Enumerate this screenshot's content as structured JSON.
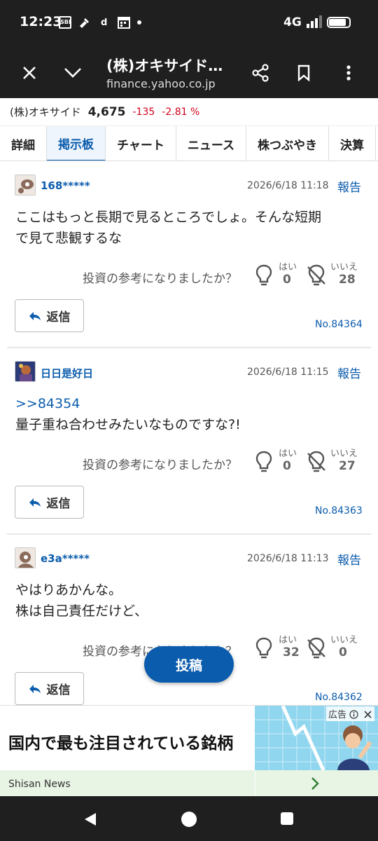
{
  "status_bar": {
    "time": "12:23",
    "network": "4G",
    "icons": [
      "sbi-icon",
      "tool-icon",
      "docomo-icon",
      "calendar-icon"
    ]
  },
  "browser": {
    "title": "(株)オキサイド…",
    "url": "finance.yahoo.co.jp"
  },
  "stock": {
    "name": "(株)オキサイド",
    "price": "4,675",
    "change": "-135",
    "change_pct": "-2.81 %"
  },
  "tabs": [
    {
      "label": "詳細"
    },
    {
      "label": "掲示板",
      "active": true
    },
    {
      "label": "チャート"
    },
    {
      "label": "ニュース"
    },
    {
      "label": "株つぶやき"
    },
    {
      "label": "決算"
    }
  ],
  "common": {
    "report_label": "報告",
    "helpful_question": "投資の参考になりましたか？",
    "yes_label": "はい",
    "no_label": "いいえ",
    "reply_label": "返信"
  },
  "posts": [
    {
      "user": "168*****",
      "date": "2026/6/18 11:18",
      "ref": "",
      "lines": [
        "ここはもっと長期で見るところでしょ。そんな短期",
        "で見て悲観するな"
      ],
      "yes": "0",
      "no": "28",
      "number": "No.84364"
    },
    {
      "user": "日日是好日",
      "date": "2026/6/18 11:15",
      "ref": ">>84354",
      "lines": [
        "量子重ね合わせみたいなものですな?!",
        ""
      ],
      "yes": "0",
      "no": "27",
      "number": "No.84363"
    },
    {
      "user": "e3a*****",
      "date": "2026/6/18 11:13",
      "ref": "",
      "lines": [
        "やはりあかんな。",
        "株は自己責任だけど、"
      ],
      "yes": "32",
      "no": "0",
      "number": "No.84362"
    }
  ],
  "post_button": "投稿",
  "ad": {
    "headline": "国内で最も注目されている銘柄",
    "source": "Shisan News",
    "label": "広告"
  },
  "colors": {
    "accent": "#0b5cad",
    "down": "#d0021b",
    "dark_bar": "#1f1f1f"
  }
}
